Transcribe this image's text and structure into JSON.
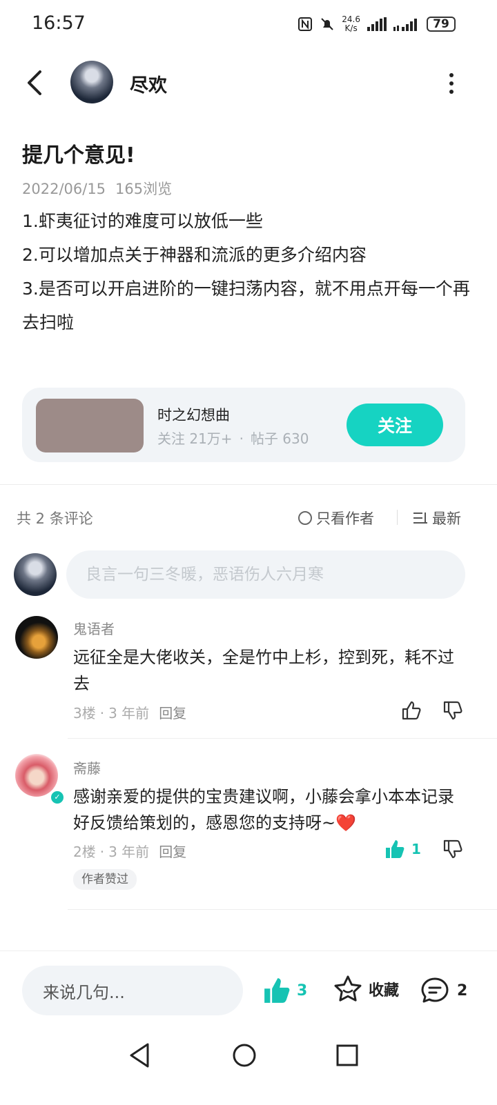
{
  "status_bar": {
    "time": "16:57",
    "net_speed_value": "24.6",
    "net_speed_unit": "K/s",
    "battery": "79",
    "icons": [
      "nfc-icon",
      "mute-icon",
      "signal-icon",
      "signal-icon-2",
      "battery-icon"
    ]
  },
  "header": {
    "username": "尽欢"
  },
  "post": {
    "title": "提几个意见!",
    "date": "2022/06/15",
    "views": "165浏览",
    "lines": [
      "1.虾夷征讨的难度可以放低一些",
      "2.可以增加点关于神器和流派的更多介绍内容",
      "3.是否可以开启进阶的一键扫荡内容，就不用点开每一个再去扫啦"
    ]
  },
  "game_card": {
    "name": "时之幻想曲",
    "followers": "关注 21万+",
    "dot": "·",
    "posts": "帖子 630",
    "follow_label": "关注"
  },
  "comments_header": {
    "count": "共 2 条评论",
    "only_author": "只看作者",
    "sort": "最新"
  },
  "comment_input": {
    "placeholder": "良言一句三冬暖，恶语伤人六月寒"
  },
  "comments": [
    {
      "name": "鬼语者",
      "text": "远征全是大佬收关，全是竹中上杉，控到死，耗不过去",
      "floor": "3楼",
      "dot": "·",
      "time": "3 年前",
      "reply": "回复"
    },
    {
      "name": "斋藤",
      "text": "感谢亲爱的提供的宝贵建议啊，小藤会拿小本本记录好反馈给策划的，感恩您的支持呀~❤️",
      "floor": "2楼",
      "dot": "·",
      "time": "3 年前",
      "reply": "回复",
      "likes": "1",
      "badge": "作者赞过"
    }
  ],
  "bottom_bar": {
    "say_placeholder": "来说几句...",
    "like_count": "3",
    "favorite_label": "收藏",
    "comment_count": "2"
  },
  "colors": {
    "accent": "#16d3c2",
    "card_bg": "#f1f4f7",
    "game_thumb": "#9d8b88"
  }
}
